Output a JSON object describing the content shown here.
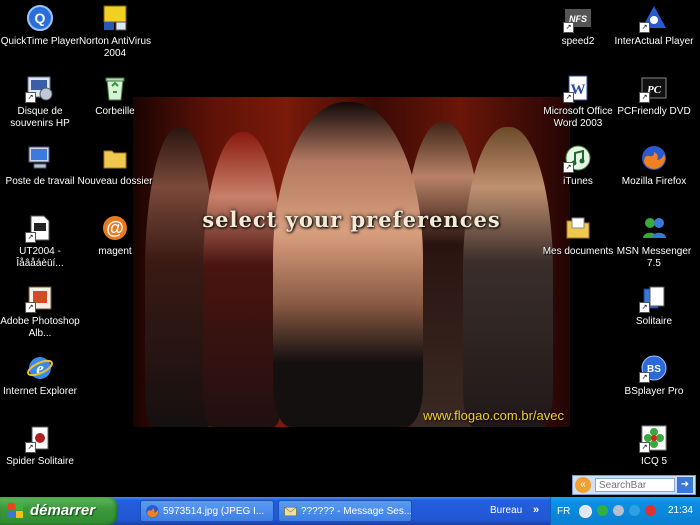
{
  "wallpaper": {
    "title": "select your preferences",
    "url": "www.flogao.com.br/avec"
  },
  "desktop_icons": {
    "quicktime": "QuickTime Player",
    "norton": "Norton AntiVirus 2004",
    "disque": "Disque de souvenirs HP",
    "corbeille": "Corbeille",
    "poste": "Poste de travail",
    "dossier": "Nouveau dossier",
    "ut2004": "UT2004 - Îåâåáèüí...",
    "magent": "magent",
    "adobe": "Adobe Photoshop Alb...",
    "ie": "Internet Explorer",
    "spider": "Spider Solitaire",
    "speed2": "speed2",
    "interactual": "InterActual Player",
    "word": "Microsoft Office Word 2003",
    "pcfriendly": "PCFriendly DVD",
    "itunes": "iTunes",
    "firefox": "Mozilla Firefox",
    "mesdocs": "Mes documents",
    "msn": "MSN Messenger 7.5",
    "solitaire": "Solitaire",
    "bsplayer": "BSplayer Pro",
    "icq": "ICQ 5"
  },
  "icon_glyphs": {
    "quicktime": "Q",
    "word": "W",
    "magent": "@",
    "pcfriendly": "PC",
    "bsplayer": "BS",
    "speed2": "NFS"
  },
  "search": {
    "placeholder": "SearchBar"
  },
  "taskbar": {
    "start_label": "démarrer",
    "tasks": [
      "5973514.jpg (JPEG I...",
      "?????? - Message Ses..."
    ],
    "bureau": "Bureau",
    "chevron": "»",
    "lang": "FR",
    "clock": "21:34"
  },
  "colors": {
    "taskbar_blue": "#245edb",
    "start_green": "#3b9b3b",
    "tray_blue": "#0c8fe0",
    "wallpaper_red": "#7a1a0a",
    "url_yellow": "#f0d020"
  }
}
